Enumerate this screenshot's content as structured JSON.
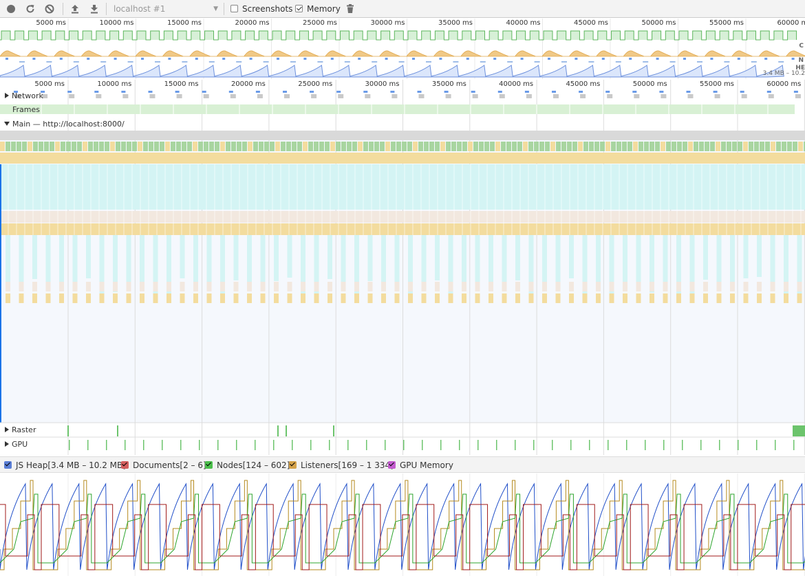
{
  "toolbar": {
    "record_icon": "record-icon",
    "reload_icon": "reload-icon",
    "clear_icon": "clear-icon",
    "load_icon": "load-profile-icon",
    "save_icon": "save-profile-icon",
    "target": "localhost #1",
    "screenshots_label": "Screenshots",
    "screenshots_checked": false,
    "memory_label": "Memory",
    "memory_checked": true,
    "trash_icon": "garbage-collect-icon"
  },
  "overview": {
    "ticks": [
      "5000 ms",
      "10000 ms",
      "15000 ms",
      "20000 ms",
      "25000 ms",
      "30000 ms",
      "35000 ms",
      "40000 ms",
      "45000 ms",
      "50000 ms",
      "55000 ms",
      "60000 ms"
    ],
    "side_labels": [
      "C",
      "N",
      "HE"
    ],
    "heap_range": "3.4 MB – 10.2",
    "colors": {
      "fps": "#6cc46c",
      "cpu_script": "#e8b96c",
      "net": "#6a9be8",
      "heap": "#7ea2e8"
    }
  },
  "timeline": {
    "ticks": [
      "5000 ms",
      "10000 ms",
      "15000 ms",
      "20000 ms",
      "25000 ms",
      "30000 ms",
      "35000 ms",
      "40000 ms",
      "45000 ms",
      "50000 ms",
      "55000 ms",
      "60000 ms"
    ],
    "network_label": "Network",
    "frames_label": "Frames",
    "main_label": "Main — http://localhost:8000/",
    "raster_label": "Raster",
    "gpu_label": "GPU"
  },
  "counters": {
    "js_heap": "JS Heap[3.4 MB – 10.2 MB]",
    "documents": "Documents[2 – 6]",
    "nodes": "Nodes[124 – 602]",
    "listeners": "Listeners[169 – 1 334]",
    "gpu_memory": "GPU Memory",
    "colors": {
      "js_heap": "#5b7fd6",
      "documents": "#d35f5f",
      "nodes": "#4cbf4c",
      "listeners": "#d4a24a",
      "gpu_memory": "#c45ccf"
    }
  }
}
